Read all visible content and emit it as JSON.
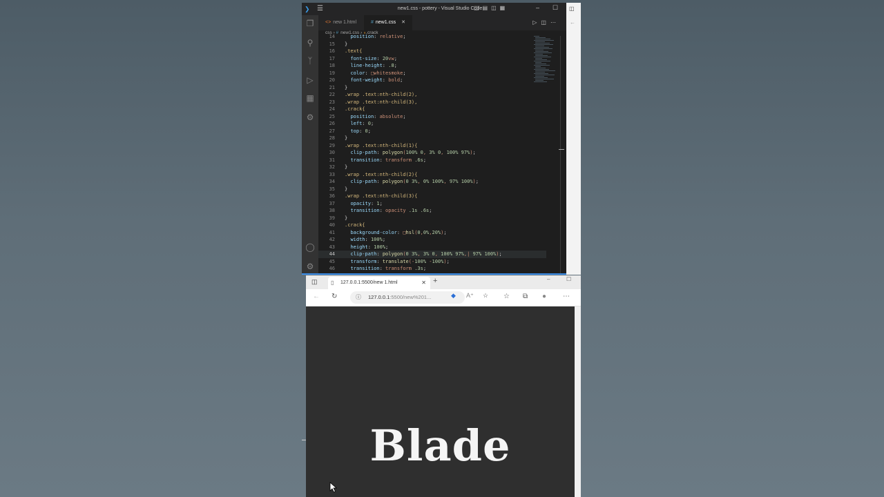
{
  "vscode": {
    "title": "new1.css - pottery - Visual Studio Code",
    "tabs": [
      {
        "label": "new 1.html",
        "icon": "html-file-icon",
        "active": false
      },
      {
        "label": "new1.css",
        "icon": "css-file-icon",
        "active": true
      }
    ],
    "breadcrumb": {
      "folder": "css",
      "file": "new1.css",
      "symbol": ".crack"
    },
    "current_line": 44,
    "code_lines": [
      {
        "n": "14",
        "text": "  position: relative;"
      },
      {
        "n": "15",
        "text": "}"
      },
      {
        "n": "16",
        "text": ".text{"
      },
      {
        "n": "17",
        "text": "  font-size: 20vw;"
      },
      {
        "n": "18",
        "text": "  line-height: .8;"
      },
      {
        "n": "19",
        "text": "  color: □whitesmoke;"
      },
      {
        "n": "20",
        "text": "  font-weight: bold;"
      },
      {
        "n": "21",
        "text": "}"
      },
      {
        "n": "22",
        "text": ".wrap .text:nth-child(2),"
      },
      {
        "n": "23",
        "text": ".wrap .text:nth-child(3),"
      },
      {
        "n": "24",
        "text": ".crack{"
      },
      {
        "n": "25",
        "text": "  position: absolute;"
      },
      {
        "n": "26",
        "text": "  left: 0;"
      },
      {
        "n": "27",
        "text": "  top: 0;"
      },
      {
        "n": "28",
        "text": "}"
      },
      {
        "n": "29",
        "text": ".wrap .text:nth-child(1){"
      },
      {
        "n": "30",
        "text": "  clip-path: polygon(100% 0, 3% 0, 100% 97%);"
      },
      {
        "n": "31",
        "text": "  transition: transform .6s;"
      },
      {
        "n": "32",
        "text": "}"
      },
      {
        "n": "33",
        "text": ".wrap .text:nth-child(2){"
      },
      {
        "n": "34",
        "text": "  clip-path: polygon(0 3%, 0% 100%, 97% 100%);"
      },
      {
        "n": "35",
        "text": "}"
      },
      {
        "n": "36",
        "text": ".wrap .text:nth-child(3){"
      },
      {
        "n": "37",
        "text": "  opacity: 1;"
      },
      {
        "n": "38",
        "text": "  transition: opacity .1s .6s;"
      },
      {
        "n": "39",
        "text": "}"
      },
      {
        "n": "40",
        "text": ".crack{"
      },
      {
        "n": "41",
        "text": "  background-color: □hsl(0,0%,20%);"
      },
      {
        "n": "42",
        "text": "  width: 100%;"
      },
      {
        "n": "43",
        "text": "  height: 100%;"
      },
      {
        "n": "44",
        "text": "  clip-path: polygon(0 3%, 3% 0, 100% 97%,| 97% 100%);"
      },
      {
        "n": "45",
        "text": "  transform: translate(-100% -100%);"
      },
      {
        "n": "46",
        "text": "  transition: transform .3s;"
      }
    ]
  },
  "browser": {
    "tab_title": "127.0.0.1:5500/new 1.html",
    "url_host": "127.0.0.1",
    "url_rest": ":5500/new%201...",
    "page_heading": "Blade"
  },
  "colors": {
    "editor_bg": "#1e1e1e",
    "selector": "#d7ba7d",
    "property": "#9cdcfe",
    "value": "#ce9178",
    "number": "#b5cea8",
    "page_bg": "#2f2f2f",
    "heading": "#f5f5f5"
  }
}
